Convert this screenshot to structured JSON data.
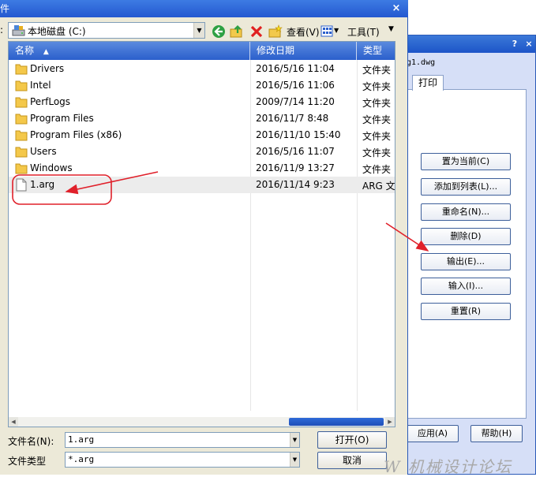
{
  "background_dialog": {
    "help_glyph": "?",
    "close_glyph": "×",
    "filename": "g1.dwg",
    "tab_label": "打印",
    "buttons": [
      "置为当前(C)",
      "添加到列表(L)...",
      "重命名(N)...",
      "删除(D)",
      "输出(E)...",
      "输入(I)...",
      "重置(R)"
    ],
    "apply_label": "应用(A)",
    "help_label": "帮助(H)"
  },
  "main_dialog": {
    "title": "件",
    "close_glyph": "×",
    "lookin_label": ":",
    "lookin_value": "本地磁盘 (C:)",
    "view_label": "查看(V)",
    "tools_label": "工具(T)",
    "columns": [
      "名称",
      "修改日期",
      "类型"
    ],
    "rows": [
      {
        "name": "Drivers",
        "date": "2016/5/16 11:04",
        "type": "文件夹",
        "kind": "folder"
      },
      {
        "name": "Intel",
        "date": "2016/5/16 11:06",
        "type": "文件夹",
        "kind": "folder"
      },
      {
        "name": "PerfLogs",
        "date": "2009/7/14 11:20",
        "type": "文件夹",
        "kind": "folder"
      },
      {
        "name": "Program Files",
        "date": "2016/11/7 8:48",
        "type": "文件夹",
        "kind": "folder"
      },
      {
        "name": "Program Files (x86)",
        "date": "2016/11/10 15:40",
        "type": "文件夹",
        "kind": "folder"
      },
      {
        "name": "Users",
        "date": "2016/5/16 11:07",
        "type": "文件夹",
        "kind": "folder"
      },
      {
        "name": "Windows",
        "date": "2016/11/9 13:27",
        "type": "文件夹",
        "kind": "folder"
      },
      {
        "name": "1.arg",
        "date": "2016/11/14 9:23",
        "type": "ARG 文件",
        "kind": "file"
      }
    ],
    "filename_label": "文件名(N):",
    "filename_value": "1.arg",
    "filetype_label": "文件类型",
    "filetype_value": "*.arg",
    "open_label": "打开(O)",
    "cancel_label": "取消"
  },
  "watermark": "W 机械设计论坛",
  "colors": {
    "titlebar": "#2458d0",
    "header": "#2b5fcc",
    "annotation": "#e0202a",
    "selected_row": "#ececec"
  }
}
